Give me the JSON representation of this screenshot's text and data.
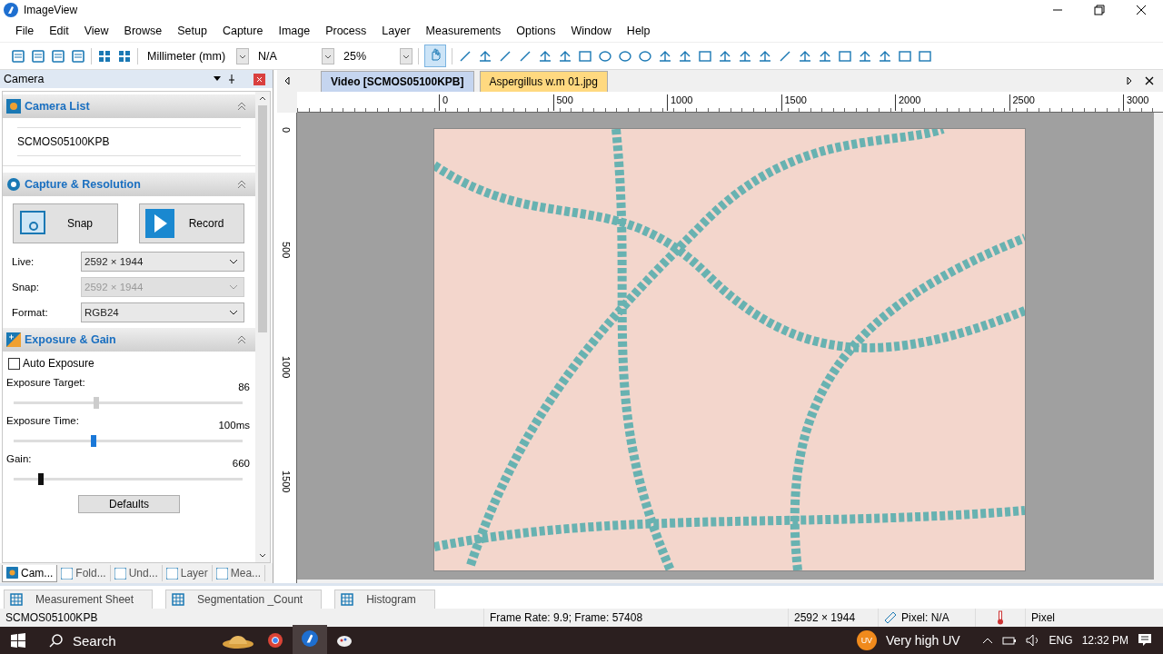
{
  "window": {
    "title": "ImageView"
  },
  "menu": [
    "File",
    "Edit",
    "View",
    "Browse",
    "Setup",
    "Capture",
    "Image",
    "Process",
    "Layer",
    "Measurements",
    "Options",
    "Window",
    "Help"
  ],
  "toolbar": {
    "combos": [
      {
        "value": "Millimeter (mm)"
      },
      {
        "value": "N/A"
      },
      {
        "value": "25%"
      }
    ],
    "pan_selected": true
  },
  "camera_panel": {
    "title": "Camera",
    "camera_list": {
      "title": "Camera List",
      "items": [
        "SCMOS05100KPB"
      ]
    },
    "capture": {
      "title": "Capture & Resolution",
      "buttons": [
        "Snap",
        "Record"
      ],
      "fields": [
        {
          "label": "Live:",
          "value": "2592 × 1944",
          "disabled": false
        },
        {
          "label": "Snap:",
          "value": "2592 × 1944",
          "disabled": true
        },
        {
          "label": "Format:",
          "value": "RGB24",
          "disabled": false
        }
      ]
    },
    "exposure": {
      "title": "Exposure & Gain",
      "auto_label": "Auto Exposure",
      "auto_checked": false,
      "sliders": [
        {
          "label": "Exposure Target:",
          "reading": "86",
          "level": 0.36
        },
        {
          "label": "Exposure Time:",
          "reading": "100ms",
          "level": 0.35
        },
        {
          "label": "Gain:",
          "reading": "660",
          "level": 0.12
        }
      ],
      "defaults_button": "Defaults"
    }
  },
  "panel_tabs": [
    {
      "label": "Cam...",
      "selected": true
    },
    {
      "label": "Fold...",
      "selected": false
    },
    {
      "label": "Und...",
      "selected": false
    },
    {
      "label": "Layer",
      "selected": false
    },
    {
      "label": "Mea...",
      "selected": false
    }
  ],
  "doc_tabs": [
    {
      "label": "Video [SCMOS05100KPB]",
      "selected": true
    },
    {
      "label": "Aspergillus w.m 01.jpg",
      "selected": false
    }
  ],
  "rulers": {
    "horizontal": [
      "0",
      "500",
      "1000",
      "1500",
      "2000",
      "2500",
      "3000"
    ],
    "vertical": [
      "0",
      "500",
      "1000",
      "1500"
    ]
  },
  "dock_tabs": [
    "Measurement Sheet",
    "Segmentation _Count",
    "Histogram"
  ],
  "status_bar": {
    "camera": "SCMOS05100KPB",
    "frame": "Frame Rate: 9.9; Frame: 57408",
    "size": "2592 × 1944",
    "pixel": "Pixel: N/A",
    "unit": "Pixel"
  },
  "taskbar": {
    "search": "Search",
    "weather_badge": "UV",
    "weather": "Very high UV",
    "language": "ENG",
    "time": "12:32 PM"
  }
}
